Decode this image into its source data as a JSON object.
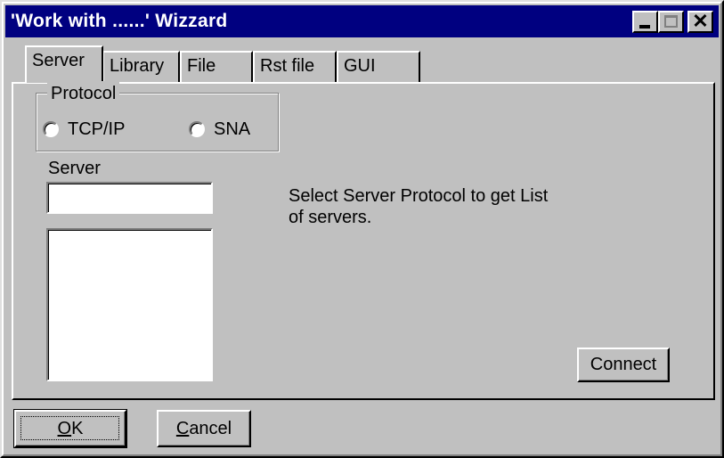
{
  "window": {
    "title": "'Work with ......' Wizzard",
    "controls": [
      "minimize-icon",
      "maximize-icon",
      "close-icon"
    ],
    "title_bar_color": "#000080"
  },
  "tabs": [
    {
      "label": "Server",
      "active": true
    },
    {
      "label": "Library",
      "active": false
    },
    {
      "label": "File",
      "active": false
    },
    {
      "label": "Rst file",
      "active": false
    },
    {
      "label": "GUI",
      "active": false
    }
  ],
  "protocol": {
    "legend": "Protocol",
    "options": [
      {
        "label": "TCP/IP",
        "selected": false
      },
      {
        "label": "SNA",
        "selected": false
      }
    ]
  },
  "server": {
    "label": "Server",
    "input_value": "",
    "list_items": []
  },
  "hint": {
    "line1": "Select Server Protocol to get List",
    "line2": "of servers."
  },
  "buttons": {
    "connect": "Connect",
    "ok_accel": "O",
    "ok_rest": "K",
    "cancel_accel": "C",
    "cancel_rest": "ancel"
  }
}
